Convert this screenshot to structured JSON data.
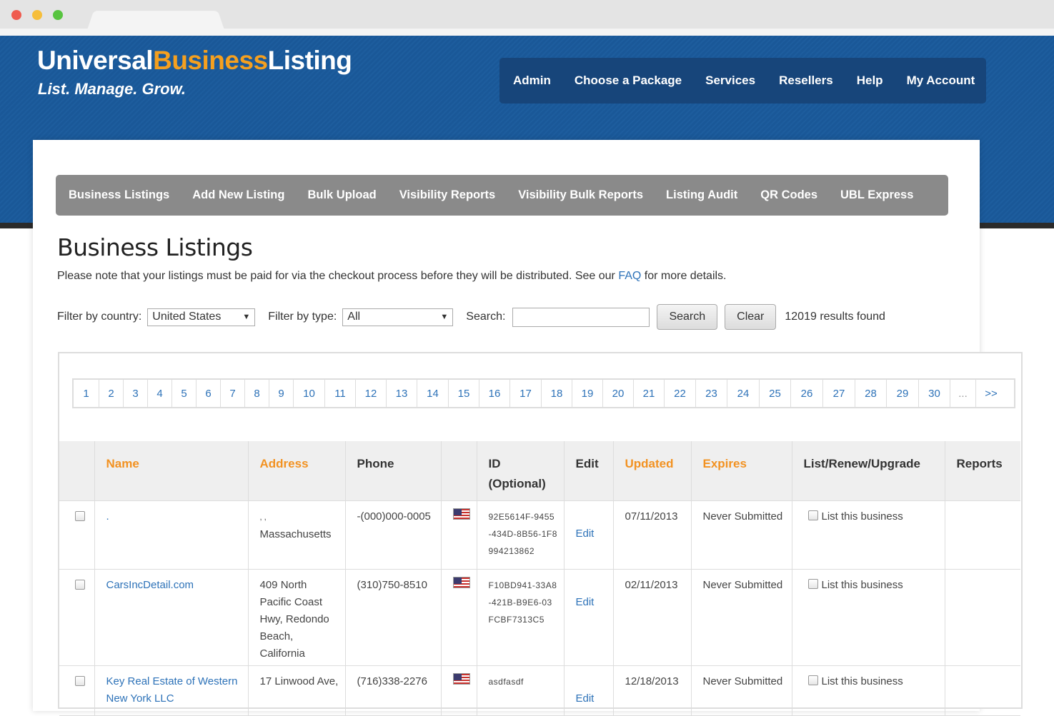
{
  "brand": {
    "logo_part1": "Universal",
    "logo_part2": "Business",
    "logo_part3": "Listing",
    "tagline": "List. Manage. Grow.",
    "colors": {
      "header_blue": "#1d5d9e",
      "accent_orange": "#f5a01f",
      "link_blue": "#2d72b8"
    }
  },
  "topnav": {
    "items": [
      "Admin",
      "Choose a Package",
      "Services",
      "Resellers",
      "Help",
      "My Account"
    ]
  },
  "subnav": {
    "items": [
      "Business Listings",
      "Add New Listing",
      "Bulk Upload",
      "Visibility Reports",
      "Visibility Bulk Reports",
      "Listing Audit",
      "QR Codes",
      "UBL Express"
    ]
  },
  "page": {
    "title": "Business Listings",
    "notice_before": "Please note that your listings must be paid for via the checkout process before they will be distributed. See our ",
    "notice_link": "FAQ",
    "notice_after": " for more details."
  },
  "filters": {
    "country_label": "Filter by country:",
    "country_value": "United States",
    "type_label": "Filter by type:",
    "type_value": "All",
    "search_label": "Search:",
    "search_value": "",
    "search_button": "Search",
    "clear_button": "Clear",
    "results": "12019 results found"
  },
  "pager": {
    "pages": [
      "1",
      "2",
      "3",
      "4",
      "5",
      "6",
      "7",
      "8",
      "9",
      "10",
      "11",
      "12",
      "13",
      "14",
      "15",
      "16",
      "17",
      "18",
      "19",
      "20",
      "21",
      "22",
      "23",
      "24",
      "25",
      "26",
      "27",
      "28",
      "29",
      "30",
      "...",
      ">>"
    ]
  },
  "table": {
    "headers": {
      "name": "Name",
      "address": "Address",
      "phone": "Phone",
      "id_line1": "ID",
      "id_line2": "(Optional)",
      "edit": "Edit",
      "updated": "Updated",
      "expires": "Expires",
      "list": "List/Renew/Upgrade",
      "reports": "Reports"
    },
    "rows": [
      {
        "name": ".",
        "address_line1": ", ,",
        "address_line2": "Massachusetts",
        "phone": "-(000)000-0005",
        "flag_icon": "us-flag-icon",
        "id": "92E5614F-9455-434D-8B56-1F8994213862",
        "edit": "Edit",
        "updated": "07/11/2013",
        "expires": "Never Submitted",
        "list": "List this business"
      },
      {
        "name": "CarsIncDetail.com",
        "address_line1": "409 North Pacific Coast Hwy, Redondo Beach, California",
        "address_line2": "",
        "phone": "(310)750-8510",
        "flag_icon": "us-flag-icon",
        "id": "F10BD941-33A8-421B-B9E6-03FCBF7313C5",
        "edit": "Edit",
        "updated": "02/11/2013",
        "expires": "Never Submitted",
        "list": "List this business"
      },
      {
        "name": "Key Real Estate of Western New York LLC",
        "address_line1": "17 Linwood Ave,",
        "address_line2": "",
        "phone": "(716)338-2276",
        "flag_icon": "us-flag-icon",
        "id": "asdfasdf",
        "edit": "Edit",
        "updated": "12/18/2013",
        "expires": "Never Submitted",
        "list": "List this business"
      }
    ]
  }
}
